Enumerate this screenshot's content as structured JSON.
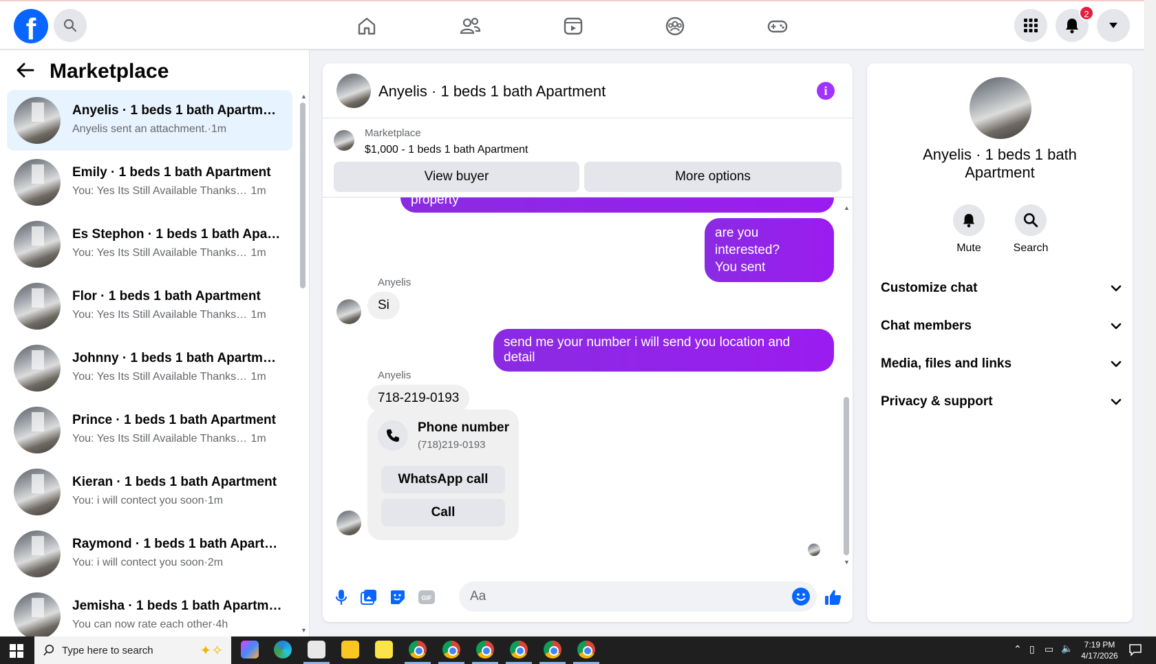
{
  "header": {
    "logo": "f",
    "notifications_count": "2"
  },
  "sidebar": {
    "title": "Marketplace",
    "conversations": [
      {
        "name": "Anyelis · 1 beds 1 bath Apartment",
        "preview": "Anyelis sent an attachment.",
        "time": "1m",
        "active": true
      },
      {
        "name": "Emily · 1 beds 1 bath Apartment",
        "preview": "You: Yes Its Still Available Thanks fo...",
        "time": "1m"
      },
      {
        "name": "Es Stephon · 1 beds 1 bath Apart...",
        "preview": "You: Yes Its Still Available Thanks fo...",
        "time": "1m"
      },
      {
        "name": "Flor · 1 beds 1 bath Apartment",
        "preview": "You: Yes Its Still Available Thanks fo...",
        "time": "1m"
      },
      {
        "name": "Johnny · 1 beds 1 bath Apartment",
        "preview": "You: Yes Its Still Available Thanks fo...",
        "time": "1m"
      },
      {
        "name": "Prince · 1 beds 1 bath Apartment",
        "preview": "You: Yes Its Still Available Thanks fo...",
        "time": "1m"
      },
      {
        "name": "Kieran · 1 beds 1 bath Apartment",
        "preview": "You: i will contect you soon",
        "time": "1m"
      },
      {
        "name": "Raymond · 1 beds 1 bath Apartm...",
        "preview": "You: i will contect you soon",
        "time": "2m"
      },
      {
        "name": "Jemisha · 1 beds 1 bath Apartment",
        "preview": "You can now rate each other",
        "time": "4h"
      }
    ]
  },
  "chat": {
    "title": "Anyelis · 1 beds 1 bath Apartment",
    "listing_label": "Marketplace",
    "listing_price": "$1,000 - 1 beds 1 bath Apartment",
    "view_buyer": "View buyer",
    "more_options": "More options",
    "messages": {
      "partial_out": "property",
      "out1_line1": "are you interested?",
      "out1_line2": "You sent",
      "sender1": "Anyelis",
      "in1": "Si",
      "out2": "send me your number i will send you location and detail",
      "sender2": "Anyelis",
      "in2": "718-219-0193"
    },
    "phone_card": {
      "title": "Phone number",
      "number": "(718)219-0193",
      "whatsapp": "WhatsApp call",
      "call": "Call"
    },
    "composer_placeholder": "Aa"
  },
  "details": {
    "name": "Anyelis · 1 beds 1 bath Apartment",
    "mute": "Mute",
    "search": "Search",
    "rows": [
      "Customize chat",
      "Chat members",
      "Media, files and links",
      "Privacy & support"
    ]
  },
  "taskbar": {
    "search_placeholder": "Type here to search",
    "time": "7:19 PM",
    "date": "4/17/2026"
  },
  "colors": {
    "brand_blue": "#0866ff",
    "outgoing_bubble": "#9b1cf0",
    "active_conversation": "#e7f3ff",
    "badge_red": "#e41e3f"
  }
}
